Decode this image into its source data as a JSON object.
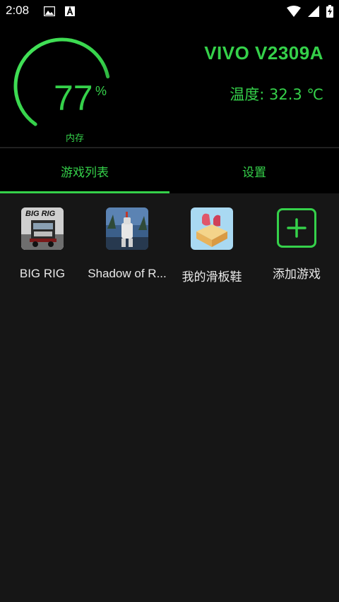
{
  "status_bar": {
    "time": "2:08",
    "icons": [
      "image-icon",
      "a-icon",
      "wifi-icon",
      "signal-icon",
      "battery-charging-icon"
    ]
  },
  "gauge": {
    "value": "77",
    "unit": "%",
    "label": "内存",
    "percent": 77,
    "color": "#35d14a"
  },
  "device": {
    "name": "VIVO V2309A",
    "temperature": "温度: 32.3 ℃"
  },
  "tabs": [
    {
      "label": "游戏列表",
      "active": true
    },
    {
      "label": "设置",
      "active": false
    }
  ],
  "games": [
    {
      "name": "BIG RIG",
      "icon": "big-rig-game-icon",
      "icon_text": "BIG RIG"
    },
    {
      "name": "Shadow of R...",
      "icon": "shadow-game-icon"
    },
    {
      "name": "我的滑板鞋",
      "icon": "skate-shoe-game-icon"
    }
  ],
  "add_game": {
    "label": "添加游戏",
    "icon": "plus-icon"
  },
  "colors": {
    "accent": "#35d14a",
    "background": "#161616",
    "header": "#000000"
  }
}
